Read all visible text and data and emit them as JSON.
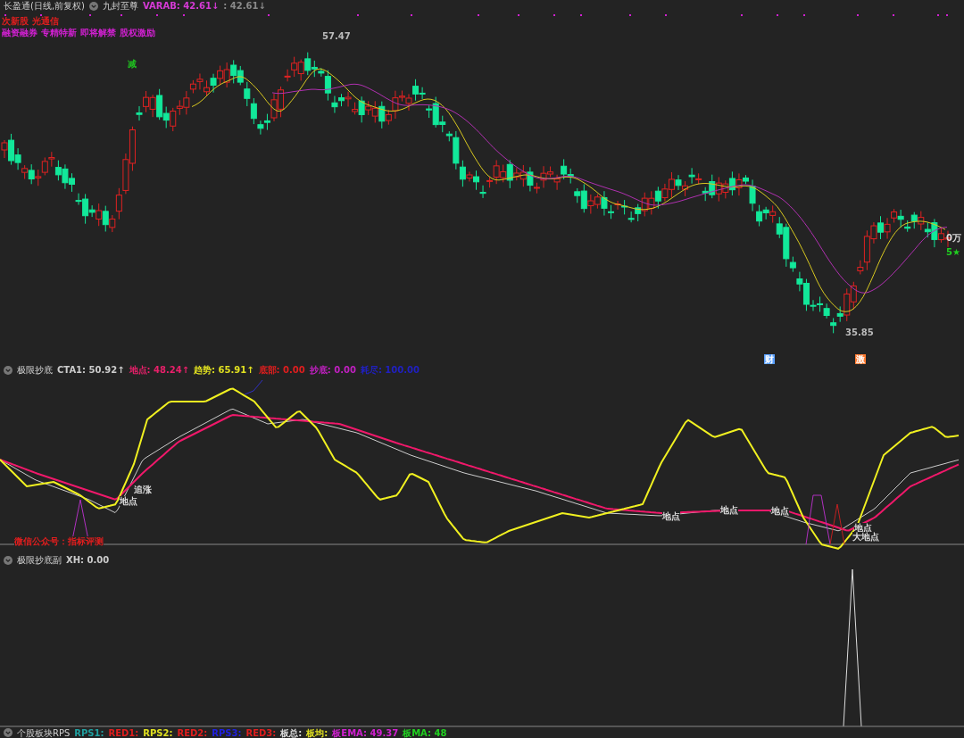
{
  "main_panel": {
    "title": "长盈通(日线,前复权)",
    "indicator_name": "九封至尊",
    "readouts": [
      {
        "text": "VARAB: 42.61",
        "arrow": "↓",
        "color": "#d63ad6"
      },
      {
        "text": ": 42.61",
        "arrow": "↓",
        "color": "#8a8a8a"
      }
    ],
    "tag_rows": [
      {
        "color": "#e01e1e",
        "tags": [
          "次新股",
          "光通信"
        ]
      },
      {
        "color": "#d020d0",
        "tags": [
          "融资融券",
          "专精特新",
          "即将解禁",
          "股权激励"
        ]
      }
    ],
    "chart_labels": [
      {
        "text": "减",
        "color": "#20c020"
      },
      {
        "text": "57.47",
        "color": "#bbbbbb"
      },
      {
        "text": "35.85",
        "color": "#bbbbbb"
      },
      {
        "text": "财",
        "color": "#5aa0ff"
      },
      {
        "text": "激",
        "color": "#ff7a30"
      },
      {
        "text": "0万",
        "color": "#dddddd"
      },
      {
        "text": "5★",
        "color": "#20d020"
      }
    ]
  },
  "indicator_panel": {
    "title": "极限抄底",
    "readouts": [
      {
        "text": "CTA1: 50.92",
        "arrow": "↑",
        "color": "#cccccc"
      },
      {
        "text": "地点: 48.24",
        "arrow": "↑",
        "color": "#e8206a"
      },
      {
        "text": "趋势: 65.91",
        "arrow": "↑",
        "color": "#e0e020"
      },
      {
        "text": "底部: 0.00",
        "color": "#e01e1e"
      },
      {
        "text": "抄底: 0.00",
        "color": "#c020c0"
      },
      {
        "text": "耗尽: 100.00",
        "color": "#2020c0"
      }
    ],
    "chart_labels": [
      {
        "text": "追涨",
        "color": "#dddddd"
      },
      {
        "text": "地点",
        "color": "#dddddd"
      },
      {
        "text": "微信公众号：指标评测",
        "color": "#e01e1e"
      },
      {
        "text": "地点",
        "color": "#dddddd"
      },
      {
        "text": "地点",
        "color": "#dddddd"
      },
      {
        "text": "地点",
        "color": "#dddddd"
      },
      {
        "text": "地点",
        "color": "#dddddd"
      },
      {
        "text": "大地点",
        "color": "#dddddd"
      }
    ]
  },
  "sub_panel": {
    "title": "极限抄底副",
    "readouts": [
      {
        "text": "XH: 0.00",
        "color": "#cccccc"
      }
    ]
  },
  "bottom_panel": {
    "title": "个股板块RPS",
    "readouts": [
      {
        "text": "RPS1:",
        "color": "#20a0a0"
      },
      {
        "text": "RED1:",
        "color": "#e01e1e"
      },
      {
        "text": "RPS2:",
        "color": "#e0e020"
      },
      {
        "text": "RED2:",
        "color": "#e01e1e"
      },
      {
        "text": "RPS3:",
        "color": "#2020e0"
      },
      {
        "text": "RED3:",
        "color": "#e01e1e"
      },
      {
        "text": "板总:",
        "color": "#dddddd"
      },
      {
        "text": "板均:",
        "color": "#e0e020"
      },
      {
        "text": "板EMA: 49.37",
        "color": "#d020d0"
      },
      {
        "text": "板MA: 48",
        "color": "#20d020"
      }
    ]
  }
}
